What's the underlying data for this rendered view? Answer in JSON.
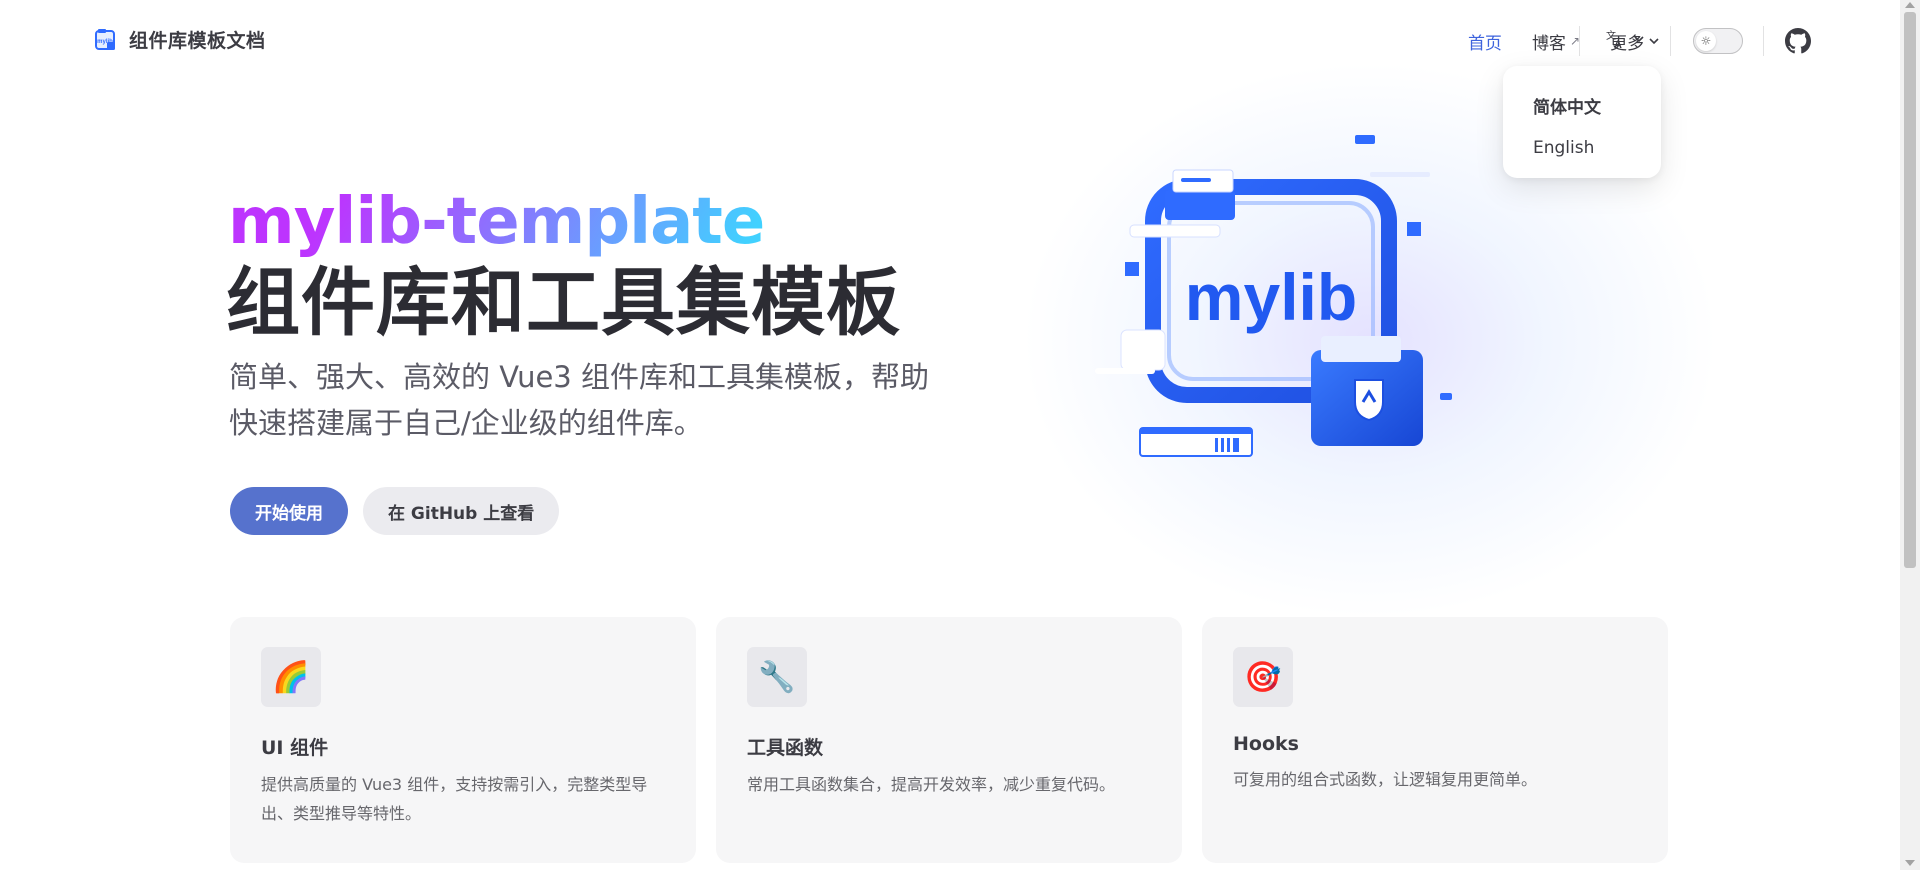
{
  "nav": {
    "title": "组件库模板文档",
    "links": [
      {
        "label": "首页",
        "active": true
      },
      {
        "label": "博客",
        "external_icon": "↗"
      },
      {
        "label": "更多",
        "dropdown_icon": "chevron-down"
      }
    ],
    "lang_icon": "translate-icon",
    "lang_glyph": "文A",
    "theme_icon": "sun-icon",
    "github_icon": "github-icon"
  },
  "lang_menu": {
    "items": [
      {
        "label": "简体中文",
        "current": true
      },
      {
        "label": "English"
      }
    ]
  },
  "hero": {
    "name": "mylib-template",
    "text": "组件库和工具集模板",
    "tagline_line1": "简单、强大、高效的 Vue3 组件库和工具集模板，帮助",
    "tagline_line2": "快速搭建属于自己/企业级的组件库。",
    "image_text": "mylib",
    "actions": [
      {
        "label": "开始使用",
        "theme": "brand"
      },
      {
        "label": "在 GitHub 上查看",
        "theme": "alt"
      }
    ]
  },
  "features": [
    {
      "icon": "🌈",
      "icon_name": "rainbow-icon",
      "title": "UI 组件",
      "details": "提供高质量的 Vue3 组件，支持按需引入，完整类型导出、类型推导等特性。"
    },
    {
      "icon": "🔧",
      "icon_name": "wrench-icon",
      "title": "工具函数",
      "details": "常用工具函数集合，提高开发效率，减少重复代码。"
    },
    {
      "icon": "🎯",
      "icon_name": "target-icon",
      "title": "Hooks",
      "details": "可复用的组合式函数，让逻辑复用更简单。"
    }
  ],
  "colors": {
    "brand": "#5672cd",
    "nav_active": "#3e63dd",
    "gradient_start": "#bd34fe",
    "gradient_end": "#41d1ff"
  }
}
